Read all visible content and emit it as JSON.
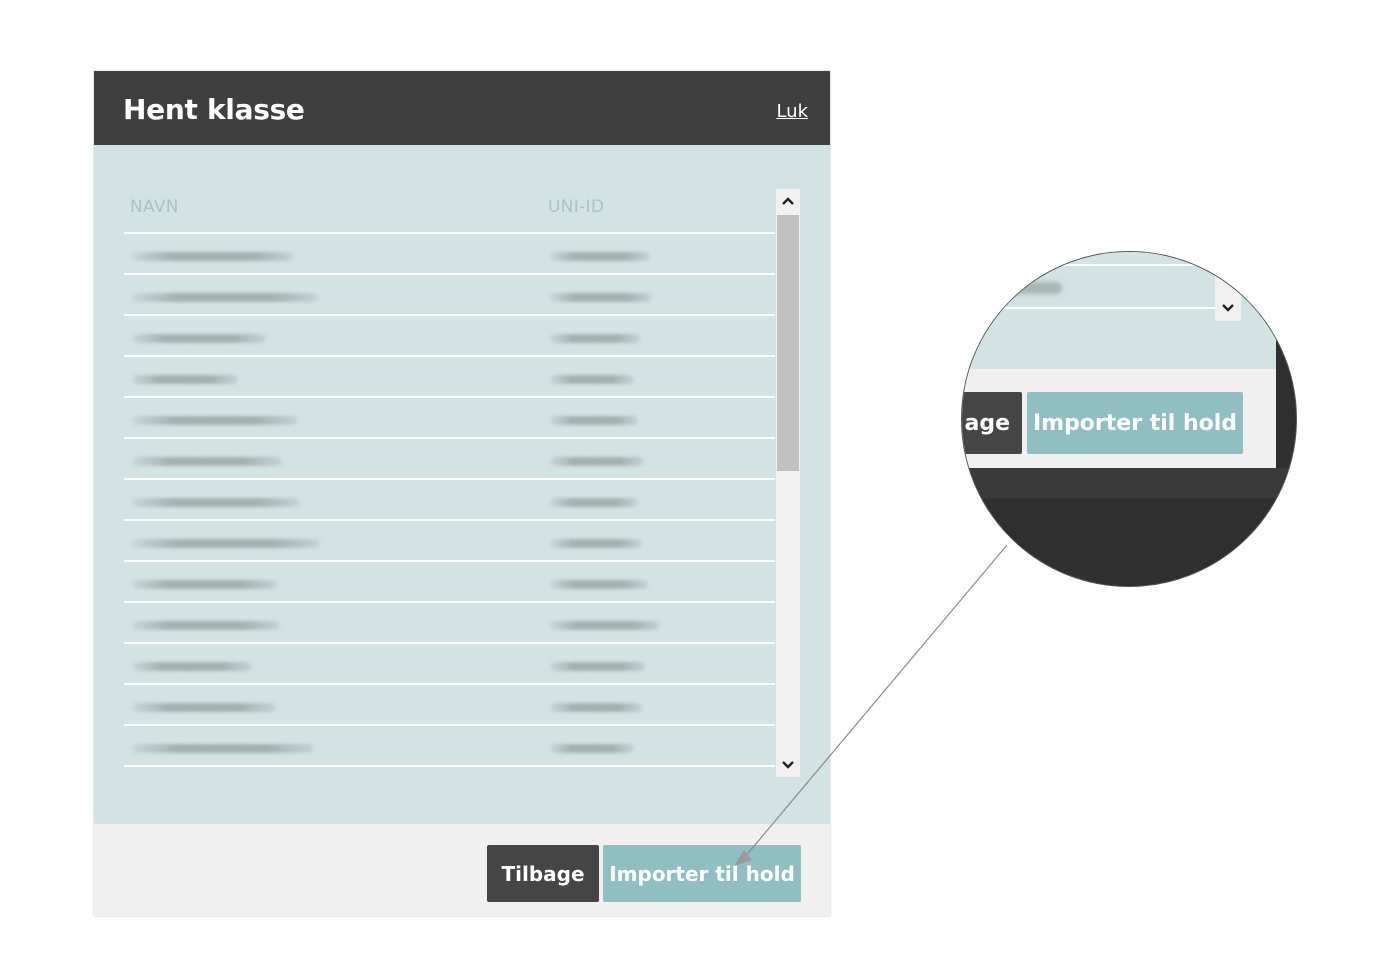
{
  "modal": {
    "title": "Hent klasse",
    "close_label": "Luk",
    "table": {
      "headers": {
        "name": "NAVN",
        "uni_id": "UNI-ID"
      },
      "rows": [
        {
          "name": "",
          "uni_id": ""
        },
        {
          "name": "",
          "uni_id": ""
        },
        {
          "name": "",
          "uni_id": ""
        },
        {
          "name": "",
          "uni_id": ""
        },
        {
          "name": "",
          "uni_id": ""
        },
        {
          "name": "",
          "uni_id": ""
        },
        {
          "name": "",
          "uni_id": ""
        },
        {
          "name": "",
          "uni_id": ""
        },
        {
          "name": "",
          "uni_id": ""
        },
        {
          "name": "",
          "uni_id": ""
        },
        {
          "name": "",
          "uni_id": ""
        },
        {
          "name": "",
          "uni_id": ""
        },
        {
          "name": "",
          "uni_id": ""
        }
      ],
      "rows_note": "redacted (blurred) in screenshot"
    },
    "scrollbar": {
      "up_icon": "chevron-up-icon",
      "down_icon": "chevron-down-icon",
      "up_glyph": "⌃",
      "down_glyph": "⌄"
    },
    "footer": {
      "back_label": "Tilbage",
      "import_label": "Importer til hold"
    }
  },
  "zoom_callout": {
    "back_label_partial": "age",
    "import_label": "Importer til hold",
    "down_glyph": "⌄"
  },
  "colors": {
    "header_bg": "#3f3f3f",
    "table_bg": "#d3e3e4",
    "header_text_muted": "#a9c4c6",
    "back_button": "#454545",
    "import_button": "#8fbfc2",
    "footer_bg": "#f0f0f0"
  }
}
